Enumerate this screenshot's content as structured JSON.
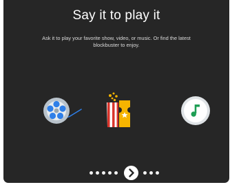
{
  "onboarding": {
    "title": "Say it to play it",
    "subtitle": "Ask it to play your favorite show, video, or music. Or find the latest blockbuster to enjoy."
  },
  "icons": [
    "film-reel-icon",
    "movie-ticket-icon",
    "music-note-icon"
  ],
  "pager": {
    "dots_before": 5,
    "dots_after": 3,
    "next_icon": "chevron-right-icon"
  },
  "colors": {
    "card_background": "#262626",
    "text": "#ffffff",
    "music_accent": "#1e9e54",
    "ticket_red": "#d9342b",
    "ticket_yellow": "#f6b400"
  }
}
